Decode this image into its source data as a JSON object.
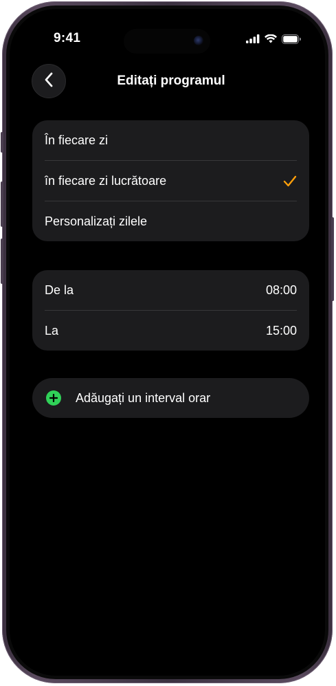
{
  "status_bar": {
    "time": "9:41",
    "icons": [
      "cellular-signal-icon",
      "wifi-icon",
      "battery-icon"
    ]
  },
  "nav": {
    "back_icon": "chevron-left-icon",
    "title": "Editați programul"
  },
  "schedule_options": [
    {
      "label": "În fiecare zi",
      "selected": false
    },
    {
      "label": "în fiecare zi lucrătoare",
      "selected": true
    },
    {
      "label": "Personalizați zilele",
      "selected": false
    }
  ],
  "time_range": {
    "from_label": "De la",
    "from_value": "08:00",
    "to_label": "La",
    "to_value": "15:00"
  },
  "add_interval": {
    "label": "Adăugați un interval orar",
    "icon": "plus-circle-icon"
  },
  "colors": {
    "accent_check": "#ff9f0a",
    "add_green": "#30d158",
    "cell_background": "#1c1c1e",
    "screen_background": "#000000"
  }
}
